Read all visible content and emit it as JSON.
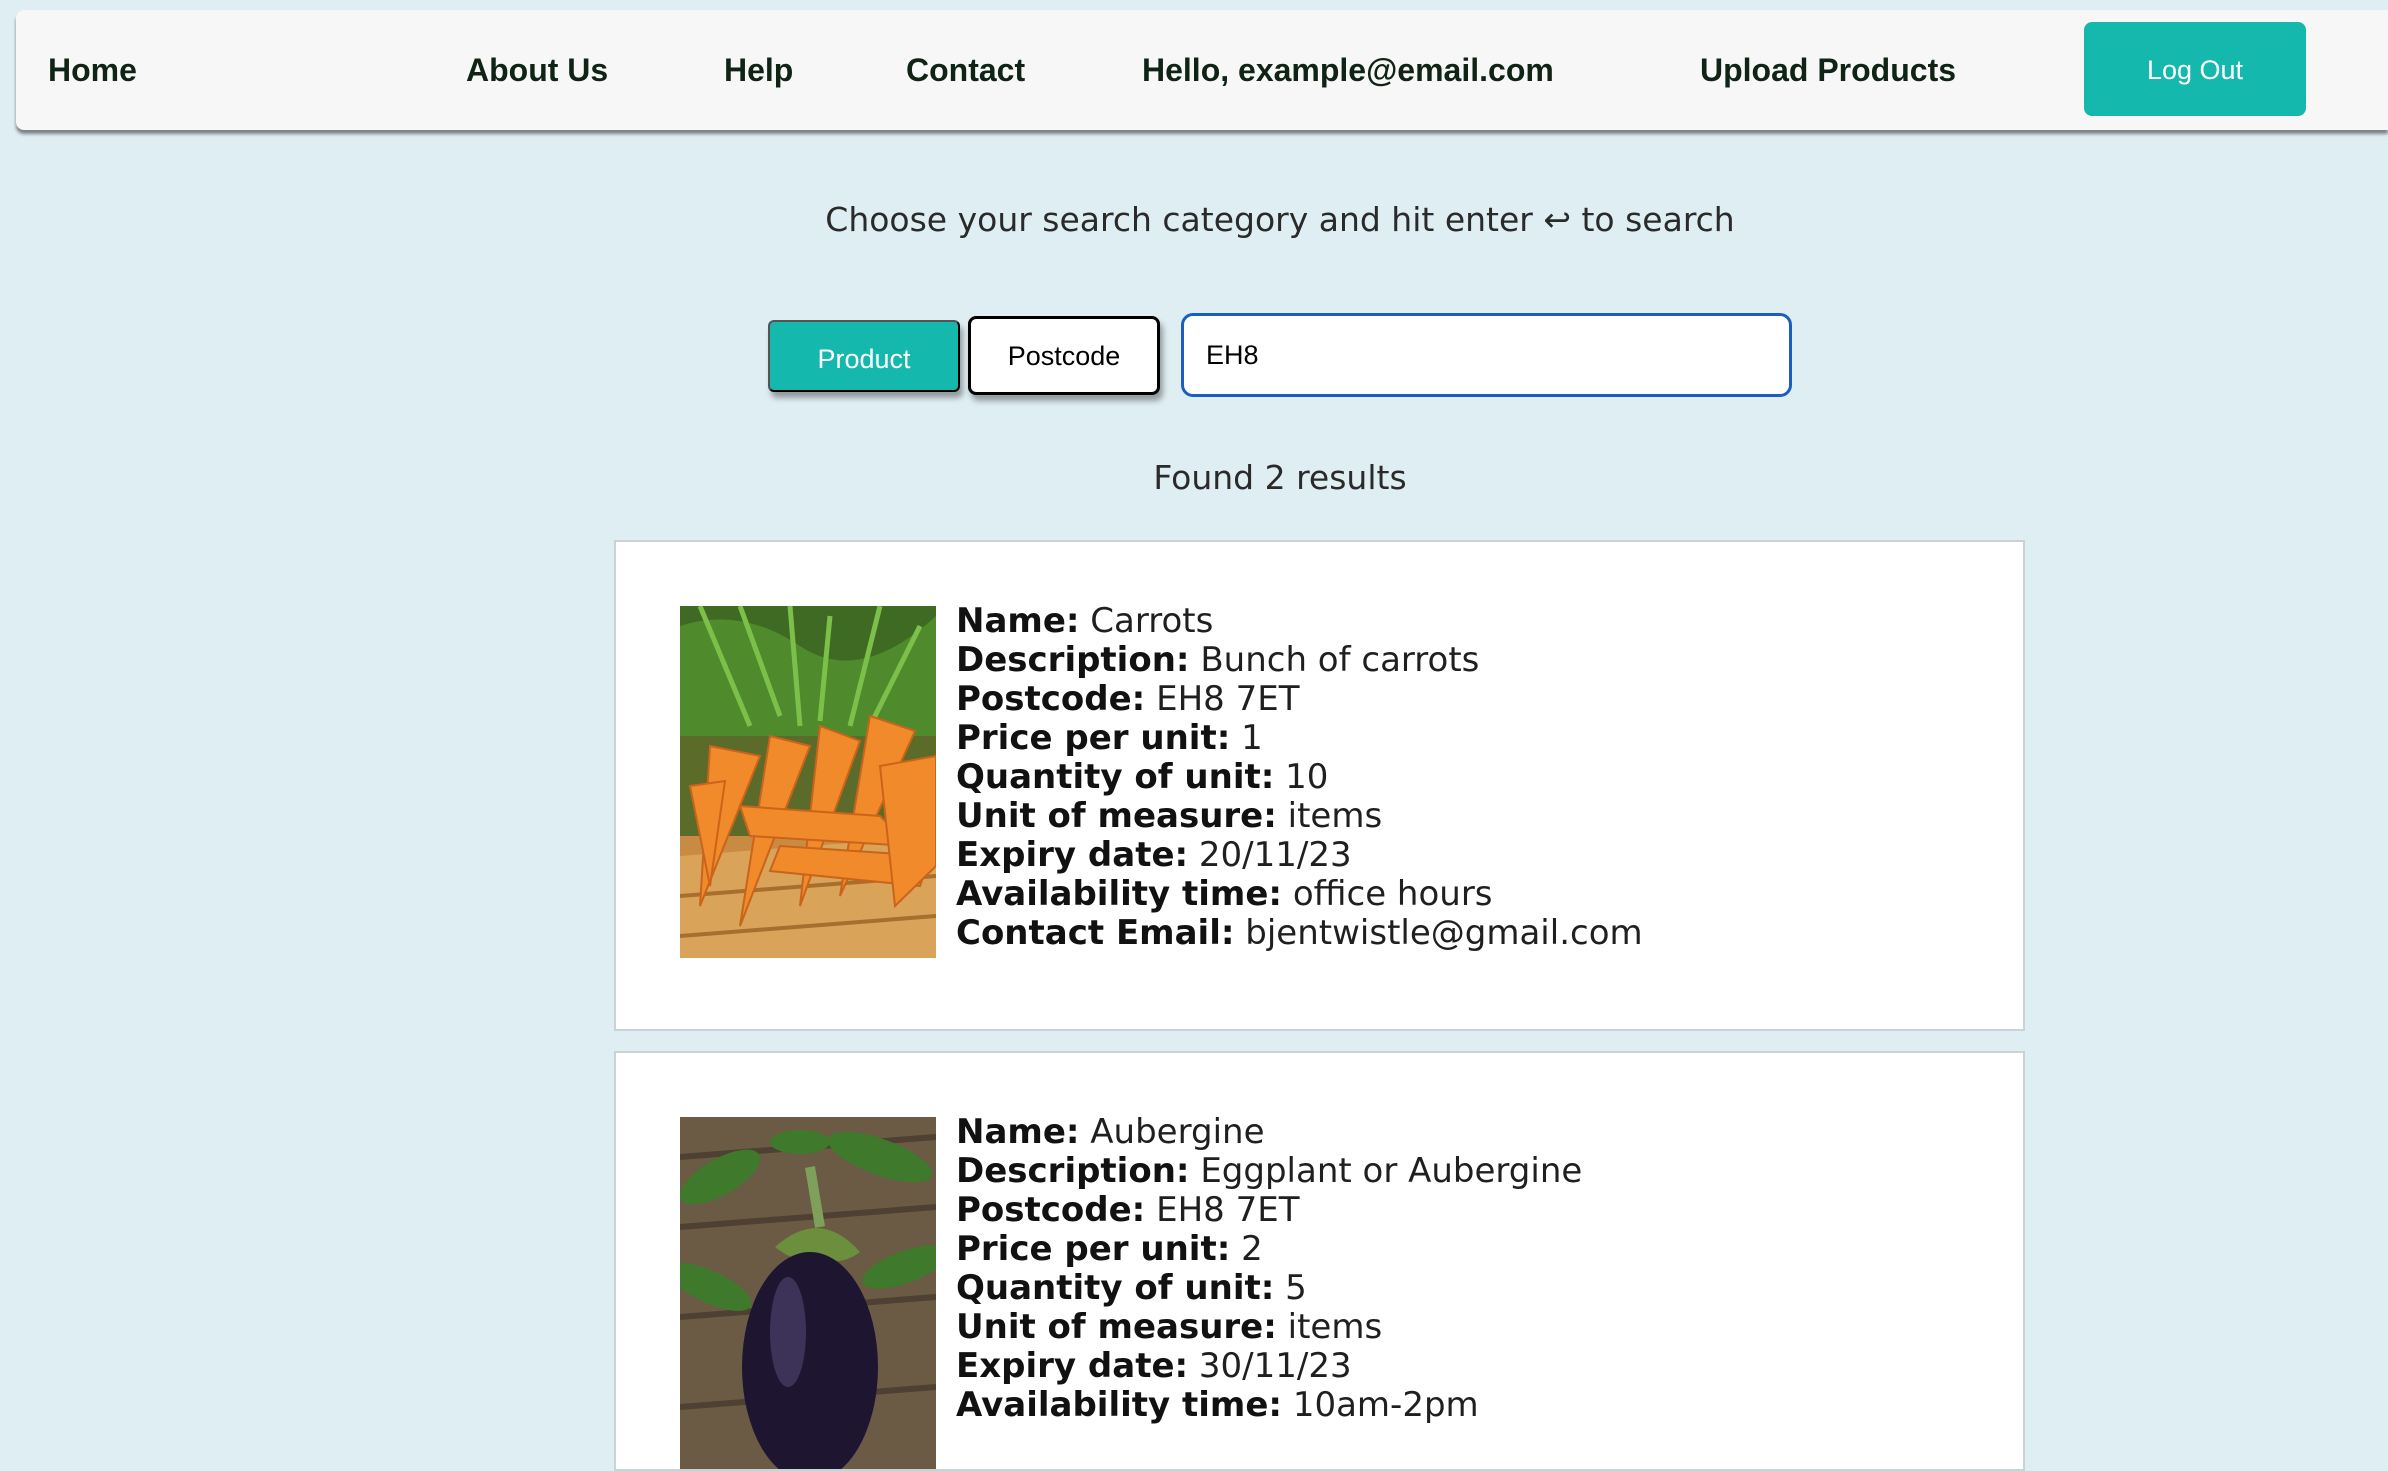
{
  "nav": {
    "home": "Home",
    "about": "About Us",
    "help": "Help",
    "contact": "Contact",
    "greeting": "Hello, example@email.com",
    "upload": "Upload Products",
    "logout": "Log Out"
  },
  "search": {
    "instructions": "Choose your search category and hit enter ↩ to search",
    "categories": [
      "Product",
      "Postcode"
    ],
    "selected_category": "Postcode",
    "query": "EH8",
    "results_text": "Found 2 results"
  },
  "labels": {
    "name": "Name:",
    "description": "Description:",
    "postcode": "Postcode:",
    "price": "Price per unit:",
    "quantity": "Quantity of unit:",
    "unit": "Unit of measure:",
    "expiry": "Expiry date:",
    "availability": "Availability time:",
    "email": "Contact Email:"
  },
  "results": [
    {
      "name": "Carrots",
      "description": "Bunch of carrots",
      "postcode": "EH8 7ET",
      "price": "1",
      "quantity": "10",
      "unit": "items",
      "expiry": "20/11/23",
      "availability": "office hours",
      "email": "bjentwistle@gmail.com"
    },
    {
      "name": "Aubergine",
      "description": "Eggplant or Aubergine",
      "postcode": "EH8 7ET",
      "price": "2",
      "quantity": "5",
      "unit": "items",
      "expiry": "30/11/23",
      "availability": "10am-2pm"
    }
  ],
  "colors": {
    "page_bg": "#dfeef3",
    "accent": "#14b8ac",
    "nav_text": "#0f2415",
    "input_border": "#1a5fc0"
  }
}
